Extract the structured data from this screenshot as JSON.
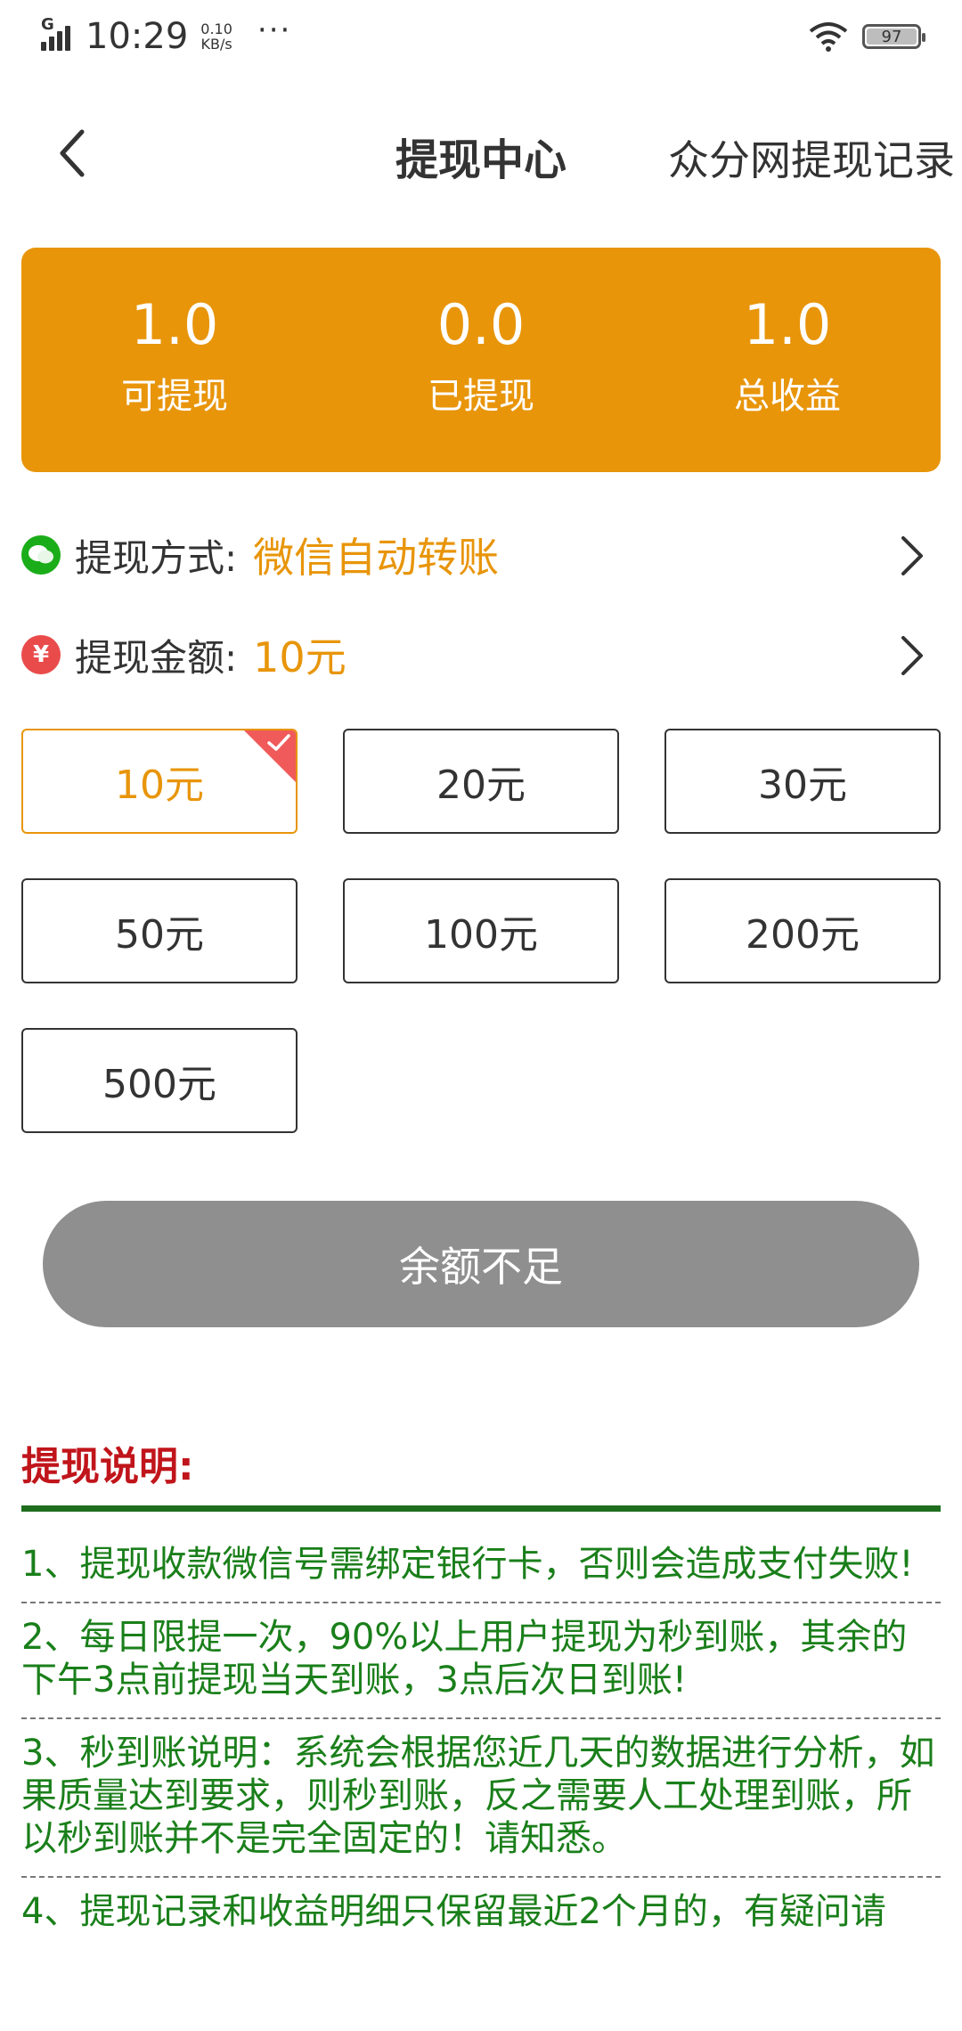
{
  "status_bar": {
    "network": "G",
    "time": "10:29",
    "speed_value": "0.10",
    "speed_unit": "KB/s",
    "more": "···",
    "battery": "97"
  },
  "header": {
    "title": "提现中心",
    "record_link": "众分网提现记录"
  },
  "summary": [
    {
      "value": "1.0",
      "label": "可提现"
    },
    {
      "value": "0.0",
      "label": "已提现"
    },
    {
      "value": "1.0",
      "label": "总收益"
    }
  ],
  "method": {
    "label": "提现方式:",
    "value": "微信自动转账",
    "icon": "wechat-icon"
  },
  "amount": {
    "label": "提现金额:",
    "value": "10元",
    "icon": "yuan-icon",
    "yuan_symbol": "¥"
  },
  "amount_options": [
    "10元",
    "20元",
    "30元",
    "50元",
    "100元",
    "200元",
    "500元"
  ],
  "selected_option": "10元",
  "submit_label": "余额不足",
  "instructions": {
    "title": "提现说明:",
    "items": [
      "1、提现收款微信号需绑定银行卡，否则会造成支付失败!",
      "2、每日限提一次，90%以上用户提现为秒到账，其余的下午3点前提现当天到账，3点后次日到账!",
      "3、秒到账说明：系统会根据您近几天的数据进行分析，如果质量达到要求，则秒到账，反之需要人工处理到账，所以秒到账并不是完全固定的！请知悉。",
      "4、提现记录和收益明细只保留最近2个月的，有疑问请"
    ]
  },
  "colors": {
    "accent": "#e8950a",
    "disabled": "#8f8f8f",
    "instruction_title": "#c0151b",
    "instruction_text": "#1a7f1a",
    "badge": "#f05a5a"
  }
}
